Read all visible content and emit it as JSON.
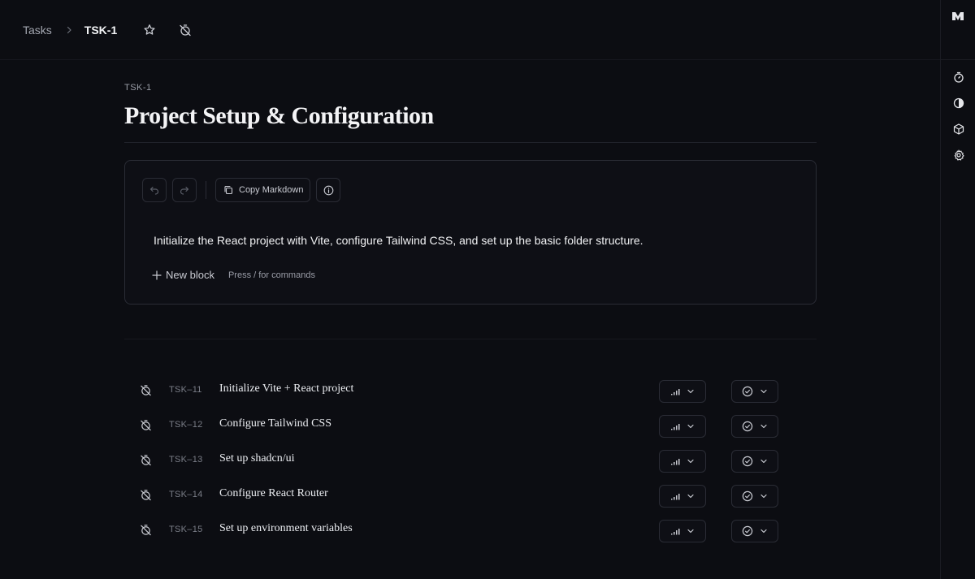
{
  "breadcrumb": {
    "parent": "Tasks",
    "current": "TSK-1"
  },
  "task": {
    "id": "TSK-1",
    "title": "Project Setup & Configuration",
    "description": "Initialize the React project with Vite, configure Tailwind CSS, and set up the basic folder structure."
  },
  "editor_toolbar": {
    "copy_label": "Copy Markdown"
  },
  "new_block": {
    "label": "New block",
    "hint": "Press / for commands"
  },
  "subtasks": [
    {
      "id": "TSK–11",
      "title": "Initialize Vite + React project"
    },
    {
      "id": "TSK–12",
      "title": "Configure Tailwind CSS"
    },
    {
      "id": "TSK–13",
      "title": "Set up shadcn/ui"
    },
    {
      "id": "TSK–14",
      "title": "Configure React Router"
    },
    {
      "id": "TSK–15",
      "title": "Set up environment variables"
    }
  ],
  "icons": {
    "top": [
      "chevron-right-icon",
      "star-icon",
      "timer-off-icon"
    ],
    "rail": [
      "logo-icon",
      "timer-icon",
      "half-circle-icon",
      "package-icon",
      "gear-icon"
    ],
    "toolbar": [
      "undo-icon",
      "redo-icon",
      "copy-icon",
      "info-icon",
      "plus-icon"
    ],
    "row": [
      "timer-off-icon",
      "signal-bars-icon",
      "chevron-down-icon",
      "check-circle-icon"
    ]
  },
  "colors": {
    "background": "#0c0d12",
    "border": "#2a2c35",
    "text": "#e7e8ec",
    "muted": "#9a9da7"
  }
}
